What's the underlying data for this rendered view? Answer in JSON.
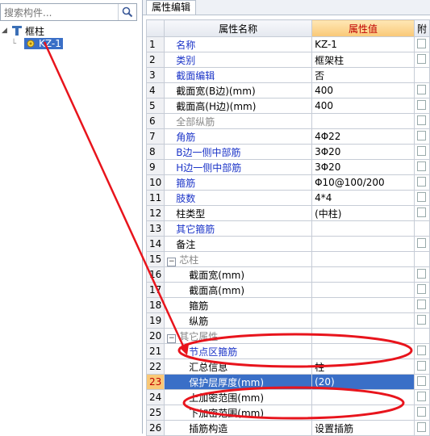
{
  "left": {
    "search_placeholder": "搜索构件...",
    "tree_root": "框柱",
    "tree_child": "KZ-1"
  },
  "tab_label": "属性编辑",
  "grid": {
    "headers": {
      "name": "属性名称",
      "value": "属性值",
      "extra": "附"
    },
    "rows": [
      {
        "num": "1",
        "name": "名称",
        "value": "KZ-1",
        "style": "blue",
        "chk": true
      },
      {
        "num": "2",
        "name": "类别",
        "value": "框架柱",
        "style": "blue",
        "chk": true
      },
      {
        "num": "3",
        "name": "截面编辑",
        "value": "否",
        "style": "blue",
        "chk": false
      },
      {
        "num": "4",
        "name": "截面宽(B边)(mm)",
        "value": "400",
        "style": "",
        "chk": true
      },
      {
        "num": "5",
        "name": "截面高(H边)(mm)",
        "value": "400",
        "style": "",
        "chk": true
      },
      {
        "num": "6",
        "name": "全部纵筋",
        "value": "",
        "style": "gray",
        "chk": true
      },
      {
        "num": "7",
        "name": "角筋",
        "value": "4Φ22",
        "style": "blue",
        "chk": true
      },
      {
        "num": "8",
        "name": "B边一侧中部筋",
        "value": "3Φ20",
        "style": "blue",
        "chk": true
      },
      {
        "num": "9",
        "name": "H边一侧中部筋",
        "value": "3Φ20",
        "style": "blue",
        "chk": true
      },
      {
        "num": "10",
        "name": "箍筋",
        "value": "Φ10@100/200",
        "style": "blue",
        "chk": true
      },
      {
        "num": "11",
        "name": "肢数",
        "value": "4*4",
        "style": "blue",
        "chk": true
      },
      {
        "num": "12",
        "name": "柱类型",
        "value": "(中柱)",
        "style": "",
        "chk": true
      },
      {
        "num": "13",
        "name": "其它箍筋",
        "value": "",
        "style": "blue",
        "chk": false
      },
      {
        "num": "14",
        "name": "备注",
        "value": "",
        "style": "",
        "chk": true
      },
      {
        "num": "15",
        "name": "芯柱",
        "value": "",
        "style": "gray",
        "group": true,
        "chk": false
      },
      {
        "num": "16",
        "name": "截面宽(mm)",
        "value": "",
        "style": "",
        "indent": 2,
        "chk": true
      },
      {
        "num": "17",
        "name": "截面高(mm)",
        "value": "",
        "style": "",
        "indent": 2,
        "chk": true
      },
      {
        "num": "18",
        "name": "箍筋",
        "value": "",
        "style": "",
        "indent": 2,
        "chk": true
      },
      {
        "num": "19",
        "name": "纵筋",
        "value": "",
        "style": "",
        "indent": 2,
        "chk": true
      },
      {
        "num": "20",
        "name": "其它属性",
        "value": "",
        "style": "gray",
        "group": true,
        "chk": false
      },
      {
        "num": "21",
        "name": "节点区箍筋",
        "value": "",
        "style": "blue",
        "indent": 2,
        "chk": true
      },
      {
        "num": "22",
        "name": "汇总信息",
        "value": "柱",
        "style": "",
        "indent": 2,
        "chk": true
      },
      {
        "num": "23",
        "name": "保护层厚度(mm)",
        "value": "(20)",
        "style": "",
        "indent": 2,
        "chk": true,
        "current": true
      },
      {
        "num": "24",
        "name": "上加密范围(mm)",
        "value": "",
        "style": "",
        "indent": 2,
        "chk": true
      },
      {
        "num": "25",
        "name": "下加密范围(mm)",
        "value": "",
        "style": "",
        "indent": 2,
        "chk": true
      },
      {
        "num": "26",
        "name": "插筋构造",
        "value": "设置插筋",
        "style": "",
        "indent": 2,
        "chk": true
      }
    ]
  },
  "colors": {
    "annotation": "#e8141c",
    "selection": "#3a6fc7"
  }
}
